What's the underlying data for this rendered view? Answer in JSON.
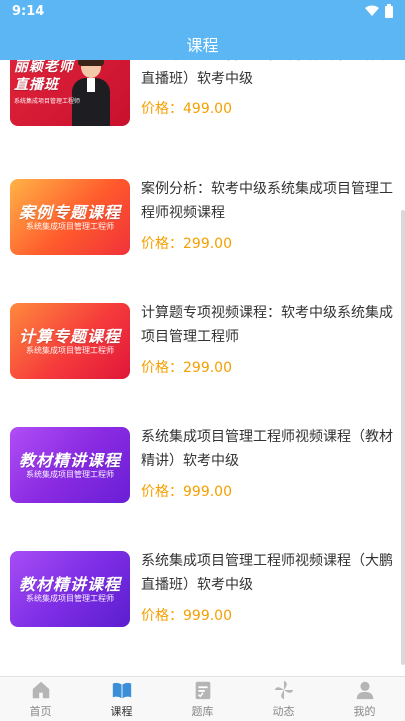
{
  "status_bar": {
    "time": "9:14"
  },
  "header": {
    "title": "课程"
  },
  "courses": [
    {
      "thumb_title": "丽颖老师 直播班",
      "thumb_sub": "系统集成项目管理工程师",
      "title": "系统集成项目管理工程师视频课程（丽颖直播班）软考中级",
      "price_label": "价格：",
      "price": "499.00"
    },
    {
      "thumb_title": "案例专题课程",
      "thumb_sub": "系统集成项目管理工程师",
      "title": "案例分析：软考中级系统集成项目管理工程师视频课程",
      "price_label": "价格：",
      "price": "299.00"
    },
    {
      "thumb_title": "计算专题课程",
      "thumb_sub": "系统集成项目管理工程师",
      "title": "计算题专项视频课程：软考中级系统集成项目管理工程师",
      "price_label": "价格：",
      "price": "299.00"
    },
    {
      "thumb_title": "教材精讲课程",
      "thumb_sub": "系统集成项目管理工程师",
      "title": "系统集成项目管理工程师视频课程（教材精讲）软考中级",
      "price_label": "价格：",
      "price": "999.00"
    },
    {
      "thumb_title": "教材精讲课程",
      "thumb_sub": "系统集成项目管理工程师",
      "title": "系统集成项目管理工程师视频课程（大鹏直播班）软考中级",
      "price_label": "价格：",
      "price": "999.00"
    }
  ],
  "tabs": [
    {
      "label": "首页",
      "icon": "home-icon",
      "active": false
    },
    {
      "label": "课程",
      "icon": "book-icon",
      "active": true
    },
    {
      "label": "题库",
      "icon": "question-bank-icon",
      "active": false
    },
    {
      "label": "动态",
      "icon": "pinwheel-icon",
      "active": false
    },
    {
      "label": "我的",
      "icon": "profile-icon",
      "active": false
    }
  ],
  "colors": {
    "header": "#5bb6f3",
    "price": "#f5a000",
    "active_tab": "#3a8fd8",
    "inactive_tab": "#b5b5b5"
  }
}
